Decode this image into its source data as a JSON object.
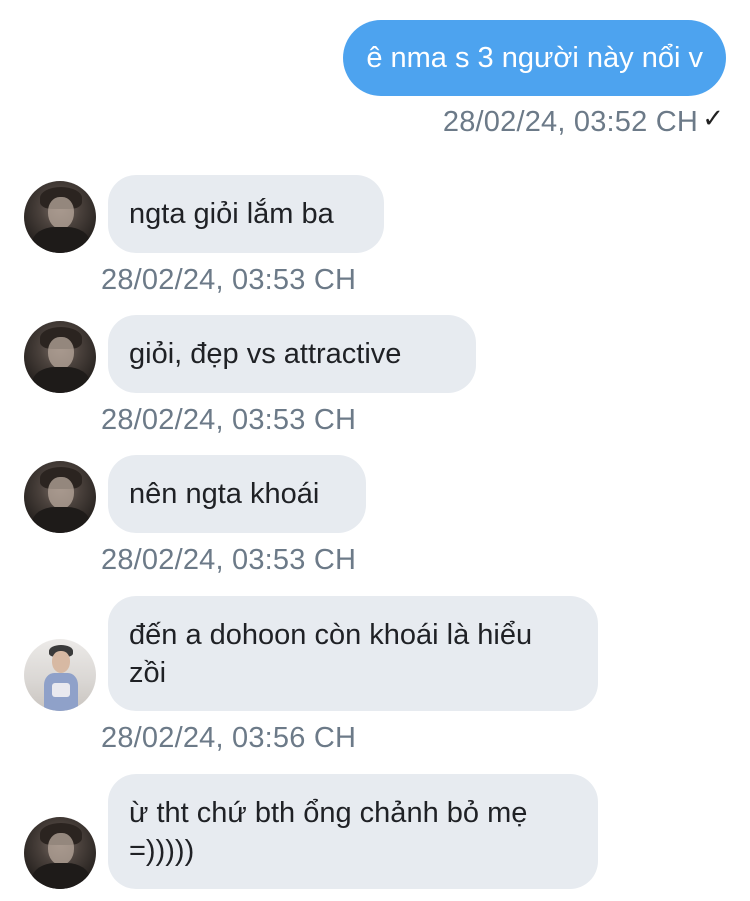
{
  "outgoing": [
    {
      "text": "ê nma s 3 người này nổi v",
      "timestamp": "28/02/24, 03:52 CH",
      "status_icon": "✓"
    }
  ],
  "incoming": [
    {
      "text": "ngta giỏi lắm ba",
      "timestamp": "28/02/24, 03:53 CH",
      "avatar": "avatar-dark"
    },
    {
      "text": "giỏi, đẹp vs attractive",
      "timestamp": "28/02/24, 03:53 CH",
      "avatar": "avatar-dark"
    },
    {
      "text": "nên ngta khoái",
      "timestamp": "28/02/24, 03:53 CH",
      "avatar": "avatar-dark"
    },
    {
      "text": "đến a dohoon còn khoái là hiểu zồi",
      "timestamp": "28/02/24, 03:56 CH",
      "avatar": "avatar-light"
    },
    {
      "text": "ừ tht chứ bth ổng chảnh bỏ mẹ =)))))",
      "avatar": "avatar-dark"
    }
  ],
  "colors": {
    "outgoing_bubble": "#4da3ef",
    "incoming_bubble": "#e7ebf0",
    "timestamp": "#6c7a88"
  }
}
